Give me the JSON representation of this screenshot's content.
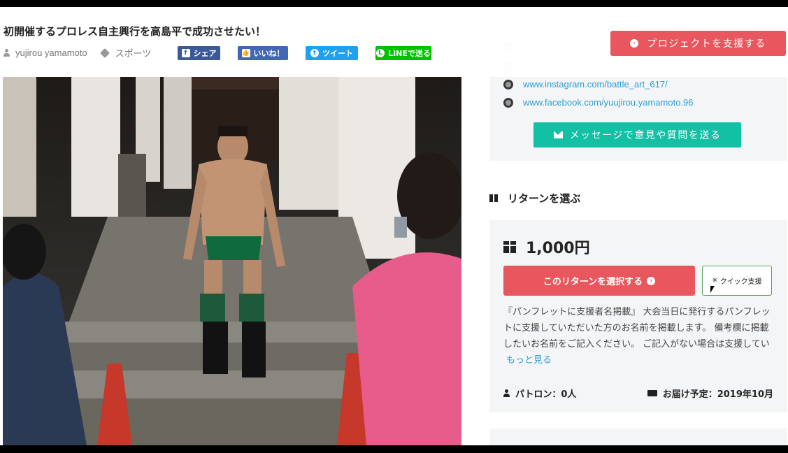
{
  "header": {
    "title": "初開催するプロレス自主興行を高島平で成功させたい！",
    "author": "yujirou yamamoto",
    "category": "スポーツ",
    "share": {
      "facebook": "シェア",
      "facebook_icon": "f",
      "like": "いいね！",
      "like_icon": "👍",
      "twitter": "ツイート",
      "twitter_icon": "t",
      "line": "LINEで送る",
      "line_icon": "L"
    },
    "support_button": "プロジェクトを支援する"
  },
  "contact": {
    "links": [
      "www.instagram.com/battle_art_617/",
      "www.facebook.com/yuujirou.yamamoto.96"
    ],
    "message_button": "メッセージで意見や質問を送る"
  },
  "returns": {
    "heading": "リターンを選ぶ",
    "items": [
      {
        "price": "1,000円",
        "select_label": "このリターンを選択する",
        "quick_label": "クイック支援",
        "description": "『パンフレットに支援者名掲載』 大会当日に発行するパンフレットに支援していただいた方のお名前を掲載します。 備考欄に掲載したいお名前をご記入ください。 ご記入がない場合は支援してい",
        "more_link": "もっと見る",
        "patrons": "パトロン：0人",
        "delivery": "お届け予定：2019年10月"
      }
    ]
  },
  "colors": {
    "primary_red": "#e9575e",
    "teal": "#12c0a4",
    "link_blue": "#2a9fd6",
    "facebook": "#3b5998",
    "twitter": "#1da1f2",
    "line": "#00c300"
  }
}
